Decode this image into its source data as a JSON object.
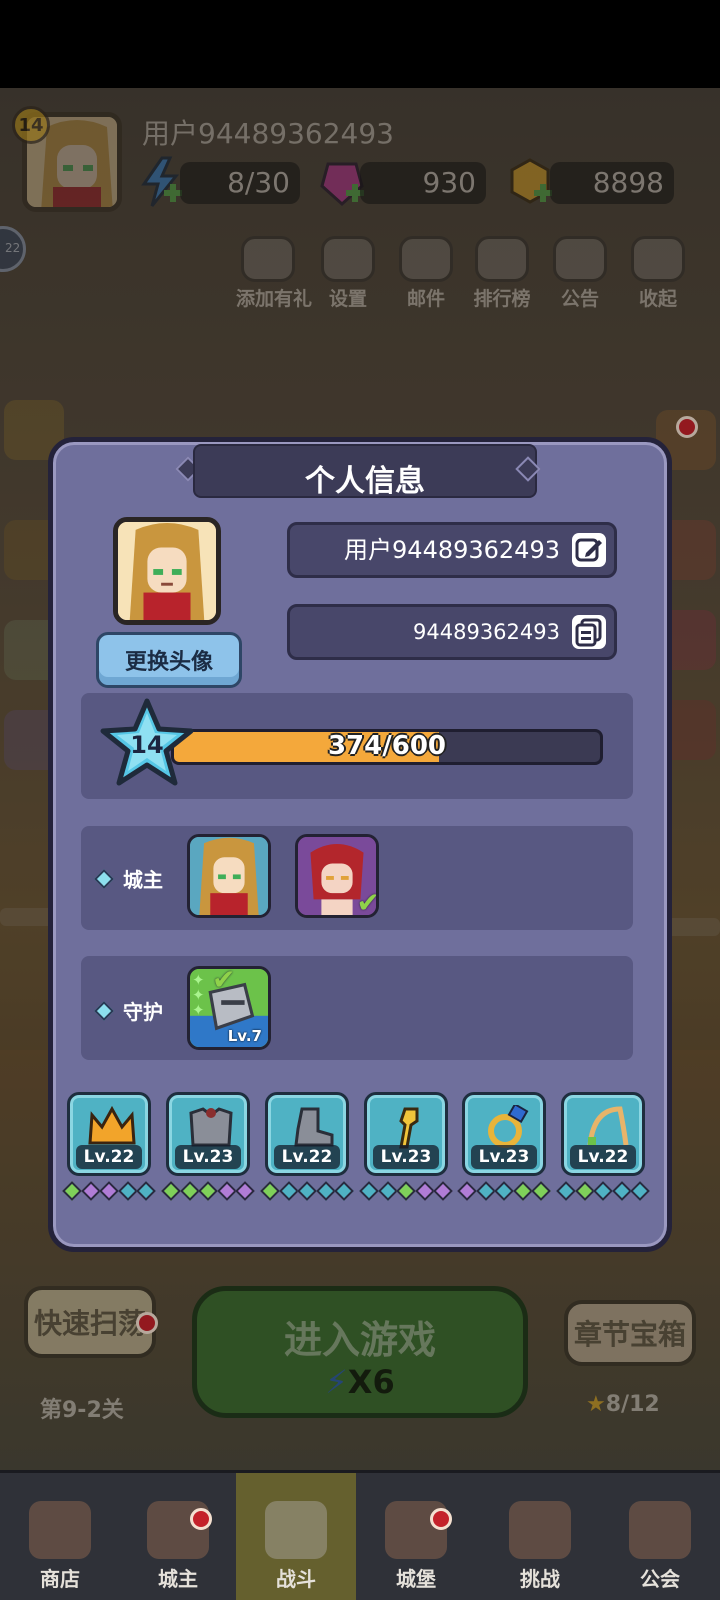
{
  "header": {
    "level": "14",
    "username": "用户94489362493",
    "energy": "8/30",
    "gems": "930",
    "gold": "8898"
  },
  "header_buttons": [
    {
      "label": "添加有礼",
      "icon": "gift-diamond-icon"
    },
    {
      "label": "设置",
      "icon": "gear-icon"
    },
    {
      "label": "邮件",
      "icon": "mail-icon"
    },
    {
      "label": "排行榜",
      "icon": "bar-chart-icon"
    },
    {
      "label": "公告",
      "icon": "megaphone-icon"
    },
    {
      "label": "收起",
      "icon": "play-icon"
    }
  ],
  "side_bubble_text": "22",
  "modal": {
    "title": "个人信息",
    "change_avatar": "更换头像",
    "name_field": "用户94489362493",
    "id_field": "94489362493",
    "level": "14",
    "xp_text": "374/600",
    "xp_progress": 0.623,
    "lord_label": "城主",
    "guard_label": "守护",
    "guard_level": "Lv.7",
    "equipment": [
      {
        "lv": "Lv.22",
        "icon": "crown-icon"
      },
      {
        "lv": "Lv.23",
        "icon": "armor-icon"
      },
      {
        "lv": "Lv.22",
        "icon": "boot-icon"
      },
      {
        "lv": "Lv.23",
        "icon": "staff-icon"
      },
      {
        "lv": "Lv.23",
        "icon": "ring-icon"
      },
      {
        "lv": "Lv.22",
        "icon": "bow-icon"
      }
    ]
  },
  "actions": {
    "quick_sweep": "快速扫荡",
    "stage": "第9-2关",
    "enter_game": "进入游戏",
    "cost": "X6",
    "chapter_chest": "章节宝箱",
    "stars": "8/12"
  },
  "nav": [
    {
      "label": "商店",
      "icon": "shop-icon"
    },
    {
      "label": "城主",
      "icon": "crown-icon"
    },
    {
      "label": "战斗",
      "icon": "crossed-swords-icon"
    },
    {
      "label": "城堡",
      "icon": "castle-icon"
    },
    {
      "label": "挑战",
      "icon": "helmet-icon"
    },
    {
      "label": "公会",
      "icon": "banner-icon"
    }
  ],
  "colors": {
    "modal_bg": "#6f6f9c",
    "xp_fill": "#f4a83b",
    "equip_bg": "#4fb2c4",
    "enter_btn": "#3d6f31"
  }
}
